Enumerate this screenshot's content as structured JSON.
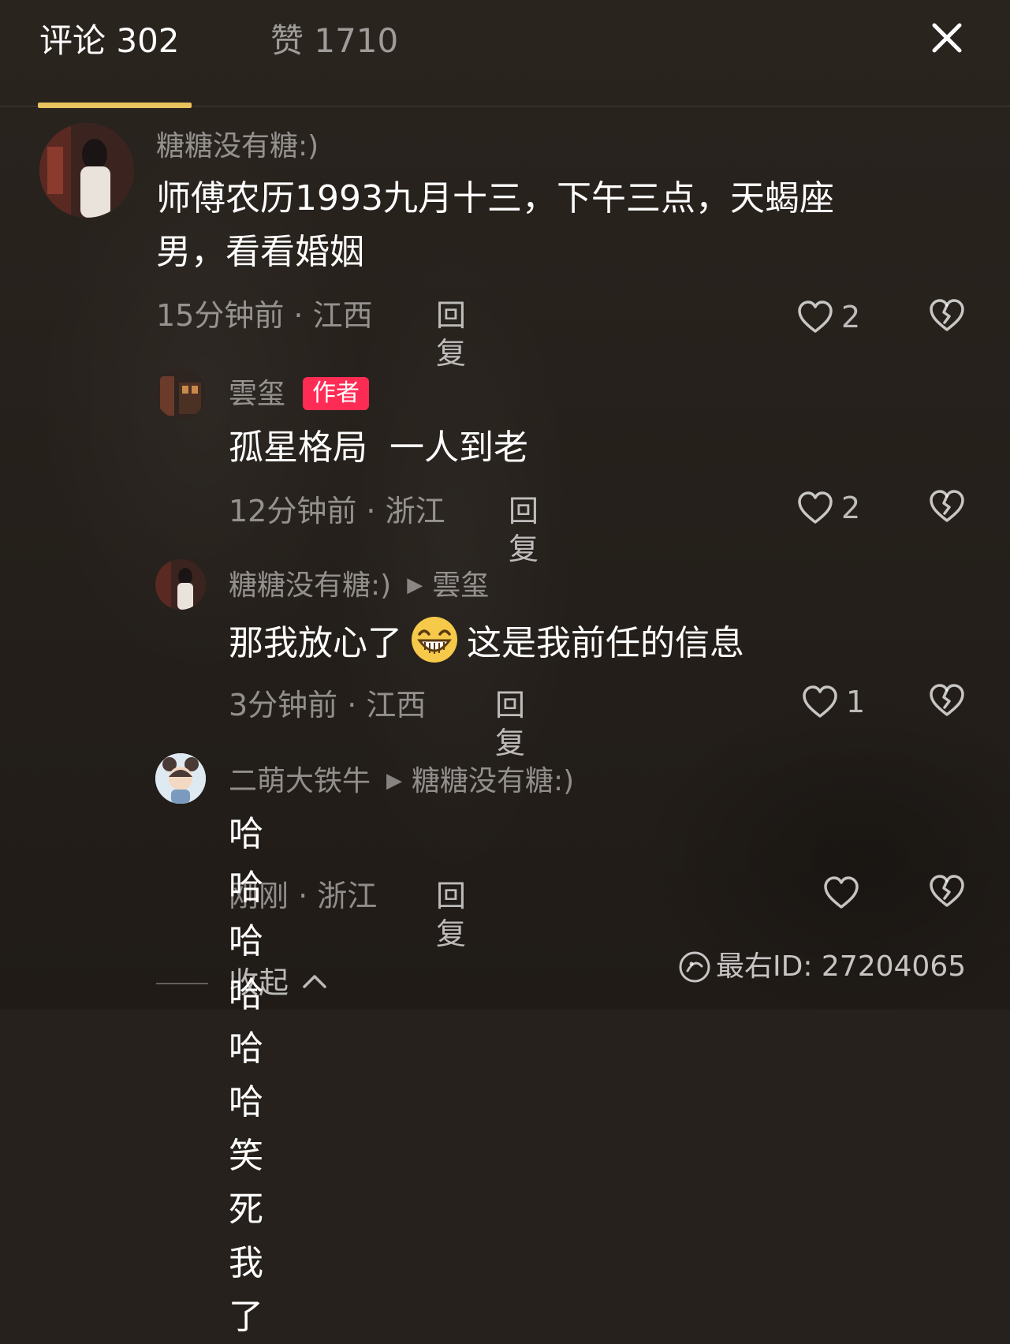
{
  "header": {
    "comments_tab": "评论 302",
    "likes_tab": "赞 1710"
  },
  "comments": [
    {
      "username": "糖糖没有糖:)",
      "text_line1": "师傅农历1993九月十三，下午三点，天蝎座",
      "text_line2": "男，看看婚姻",
      "meta": "15分钟前 · 江西",
      "reply": "回复",
      "likes": "2"
    },
    {
      "username": "雲玺",
      "badge": "作者",
      "text": "孤星格局  一人到老",
      "meta": "12分钟前 · 浙江",
      "reply": "回复",
      "likes": "2"
    },
    {
      "username": "糖糖没有糖:)",
      "reply_to": "雲玺",
      "text_before": "那我放心了",
      "emoji": "grinning-face-emoji",
      "text_after": "这是我前任的信息",
      "meta": "3分钟前 · 江西",
      "reply": "回复",
      "likes": "1"
    },
    {
      "username": "二萌大铁牛",
      "reply_to": "糖糖没有糖:)",
      "text": "哈哈哈哈哈哈笑死我了",
      "meta": "刚刚 · 浙江",
      "reply": "回复",
      "likes": ""
    }
  ],
  "collapse_label": "收起",
  "watermark": "最右ID: 27204065",
  "colors": {
    "accent_underline": "#e8c15a",
    "author_badge": "#fe2c55",
    "background": "#26211c"
  }
}
